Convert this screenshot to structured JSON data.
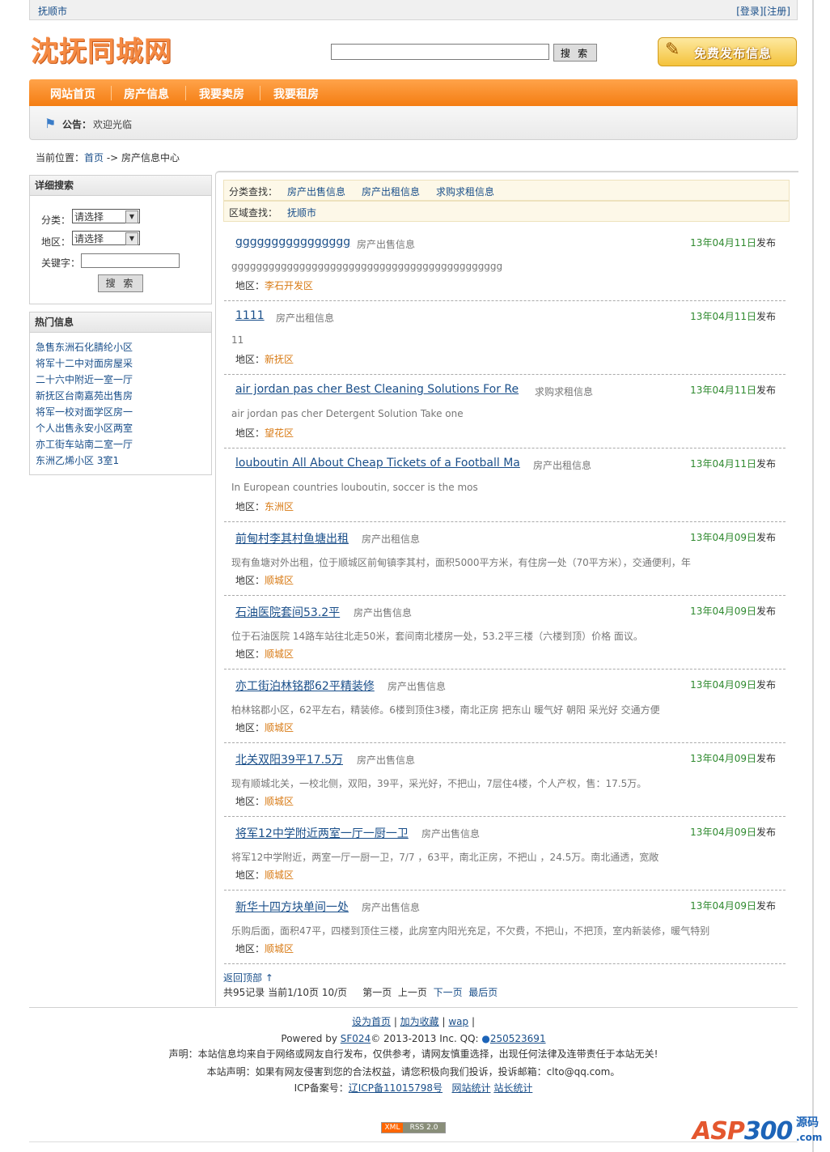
{
  "topbar": {
    "city": "抚顺市",
    "login": "[登录]",
    "register": "[注册]"
  },
  "logo": "沈抚同城网",
  "search": {
    "placeholder": "",
    "button": "搜 索"
  },
  "publish": "免费发布信息",
  "nav": [
    "网站首页",
    "房产信息",
    "我要卖房",
    "我要租房"
  ],
  "notice": {
    "label": "公告：",
    "text": "欢迎光临"
  },
  "breadcrumb": {
    "prefix": "当前位置：",
    "home": "首页",
    "sep": " -> ",
    "current": "房产信息中心"
  },
  "detail_search": {
    "title": "详细搜索",
    "category_label": "分类：",
    "category_value": "请选择",
    "region_label": "地区：",
    "region_value": "请选择",
    "keyword_label": "关键字：",
    "button": "搜 索"
  },
  "hot": {
    "title": "热门信息",
    "items": [
      "急售东洲石化腈纶小区",
      "将军十二中对面房屋采",
      "二十六中附近一室一厅",
      "新抚区台南嘉苑出售房",
      "将军一校对面学区房一",
      "个人出售永安小区两室",
      "亦工街车站南二室一厅",
      "东洲乙烯小区  3室1"
    ]
  },
  "filters": {
    "category_label": "分类查找：",
    "categories": [
      "房产出售信息",
      "房产出租信息",
      "求购求租信息"
    ],
    "region_label": "区域查找：",
    "regions": [
      "抚顺市"
    ]
  },
  "area_label": "地区：",
  "posted_suffix": "发布",
  "posts": [
    {
      "title": "gggggggggggggggg",
      "category": "房产出售信息",
      "date": "13年04月11日",
      "desc": "gggggggggggggggggggggggggggggggggggggggggggg",
      "area": "李石开发区"
    },
    {
      "title": "1111",
      "category": "房产出租信息",
      "date": "13年04月11日",
      "desc": "11",
      "area": "新抚区"
    },
    {
      "title": "air jordan pas cher Best Cleaning Solutions For Re",
      "category": "求购求租信息",
      "date": "13年04月11日",
      "desc": "air jordan pas cher Detergent Solution Take one",
      "area": "望花区"
    },
    {
      "title": "louboutin All About Cheap Tickets of a Football Ma",
      "category": "房产出租信息",
      "date": "13年04月11日",
      "desc": "In European countries louboutin, soccer is the mos",
      "area": "东洲区"
    },
    {
      "title": "前甸村李其村鱼塘出租",
      "category": "房产出租信息",
      "date": "13年04月09日",
      "desc": "现有鱼塘对外出租，位于顺城区前甸镇李其村，面积5000平方米，有住房一处（70平方米），交通便利，年",
      "area": "顺城区"
    },
    {
      "title": "石油医院套间53.2平",
      "category": "房产出售信息",
      "date": "13年04月09日",
      "desc": "位于石油医院 14路车站往北走50米，套间南北楼房一处，53.2平三楼（六楼到顶）价格 面议。",
      "area": "顺城区"
    },
    {
      "title": "亦工街泊林铭郡62平精装修",
      "category": "房产出售信息",
      "date": "13年04月09日",
      "desc": "柏林铭郡小区，62平左右，精装修。6楼到顶住3楼，南北正房 把东山 暖气好 朝阳 采光好 交通方便",
      "area": "顺城区"
    },
    {
      "title": "北关双阳39平17.5万",
      "category": "房产出售信息",
      "date": "13年04月09日",
      "desc": "现有顺城北关，一校北侧，双阳，39平，采光好，不把山，7层住4楼，个人产权，售：17.5万。",
      "area": "顺城区"
    },
    {
      "title": "将军12中学附近两室一厅一厨一卫",
      "category": "房产出售信息",
      "date": "13年04月09日",
      "desc": "将军12中学附近，两室一厅一厨一卫，7/7 ，63平，南北正房，不把山 ，24.5万。南北通透，宽敞",
      "area": "顺城区"
    },
    {
      "title": "新华十四方块单间一处",
      "category": "房产出售信息",
      "date": "13年04月09日",
      "desc": "乐购后面，面积47平，四楼到顶住三楼，此房室内阳光充足，不欠费，不把山，不把顶，室内新装修，暖气特别",
      "area": "顺城区"
    }
  ],
  "back_top": "返回顶部 ↑",
  "pager": {
    "summary": "共95记录  当前1/10页  10/页",
    "first": "第一页",
    "prev": "上一页",
    "next": "下一页",
    "last": "最后页"
  },
  "footer": {
    "links": [
      "设为首页",
      "加为收藏",
      "wap"
    ],
    "powered_prefix": "Powered by ",
    "powered_link": "SF024",
    "copyright": "© 2013-2013 Inc. QQ: ",
    "qq": "250523691",
    "statement1": "声明：本站信息均来自于网络或网友自行发布，仅供参考，请网友慎重选择，出现任何法律及连带责任于本站无关!",
    "statement2": "本站声明：如果有网友侵害到您的合法权益，请您积极向我们投诉，投诉邮箱：clto@qq.com。",
    "icp_label": "ICP备案号：",
    "icp": "辽ICP备11015798号",
    "stat1": "网站统计",
    "stat2": "站长统计"
  },
  "rss": {
    "xml": "XML",
    "rss": "RSS 2.0"
  },
  "watermark": {
    "asp": "ASP",
    "num": "300",
    "yuan": "源码",
    "com": ".com"
  }
}
